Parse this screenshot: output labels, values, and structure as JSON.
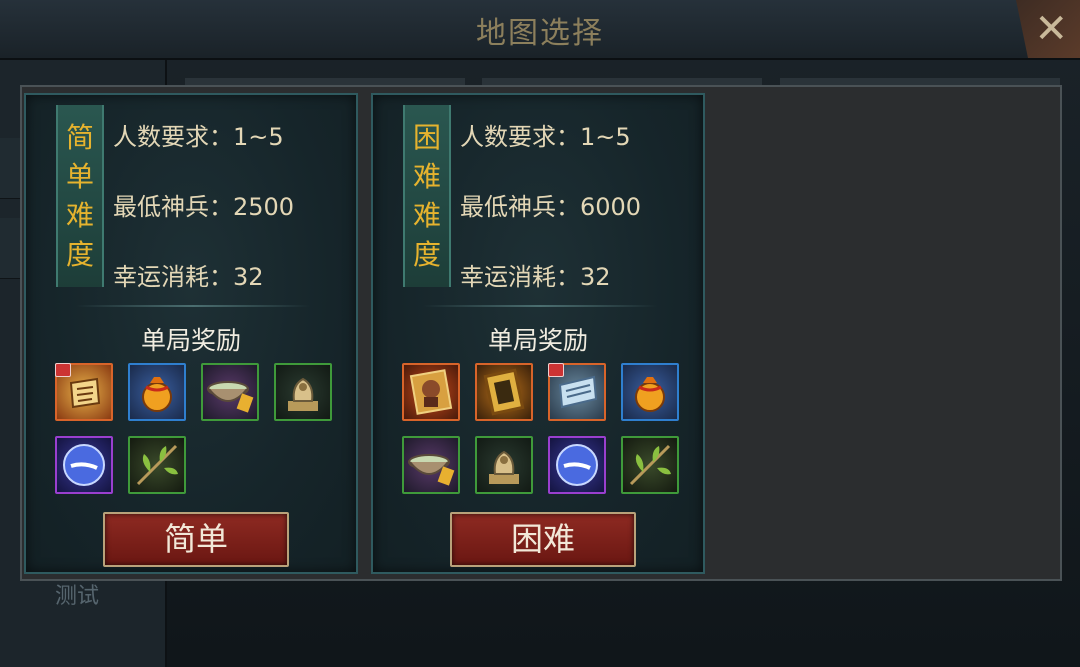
{
  "window": {
    "title": "地图选择",
    "close_icon": "close-icon"
  },
  "sidebar": {
    "item_label": "测试"
  },
  "cards": [
    {
      "difficulty_label": [
        "简",
        "单",
        "难",
        "度"
      ],
      "stats": {
        "players": "人数要求：1~5",
        "min_power": "最低神兵：2500",
        "luck_cost": "幸运消耗：32"
      },
      "reward_title": "单局奖励",
      "button_label": "简单",
      "rewards": [
        {
          "icon": "scroll-icon",
          "rarity": "orange",
          "locked": true
        },
        {
          "icon": "money-bag-icon",
          "rarity": "blue",
          "locked": false
        },
        {
          "icon": "bowl-icon",
          "rarity": "green",
          "locked": false
        },
        {
          "icon": "bronze-beast-icon",
          "rarity": "green",
          "locked": false
        },
        {
          "icon": "blue-orb-icon",
          "rarity": "purple",
          "locked": false
        },
        {
          "icon": "herb-leaf-icon",
          "rarity": "green",
          "locked": false
        }
      ]
    },
    {
      "difficulty_label": [
        "困",
        "难",
        "难",
        "度"
      ],
      "stats": {
        "players": "人数要求：1~5",
        "min_power": "最低神兵：6000",
        "luck_cost": "幸运消耗：32"
      },
      "reward_title": "单局奖励",
      "button_label": "困难",
      "rewards": [
        {
          "icon": "warrior-card-icon",
          "rarity": "orange",
          "locked": false
        },
        {
          "icon": "golden-frame-icon",
          "rarity": "orange",
          "locked": false
        },
        {
          "icon": "silver-scroll-icon",
          "rarity": "orange",
          "locked": true
        },
        {
          "icon": "money-bag-icon",
          "rarity": "blue",
          "locked": false
        },
        {
          "icon": "bowl-icon",
          "rarity": "green",
          "locked": false
        },
        {
          "icon": "bronze-beast-icon",
          "rarity": "green",
          "locked": false
        },
        {
          "icon": "blue-orb-icon",
          "rarity": "purple",
          "locked": false
        },
        {
          "icon": "herb-leaf-icon",
          "rarity": "green",
          "locked": false
        }
      ]
    }
  ]
}
